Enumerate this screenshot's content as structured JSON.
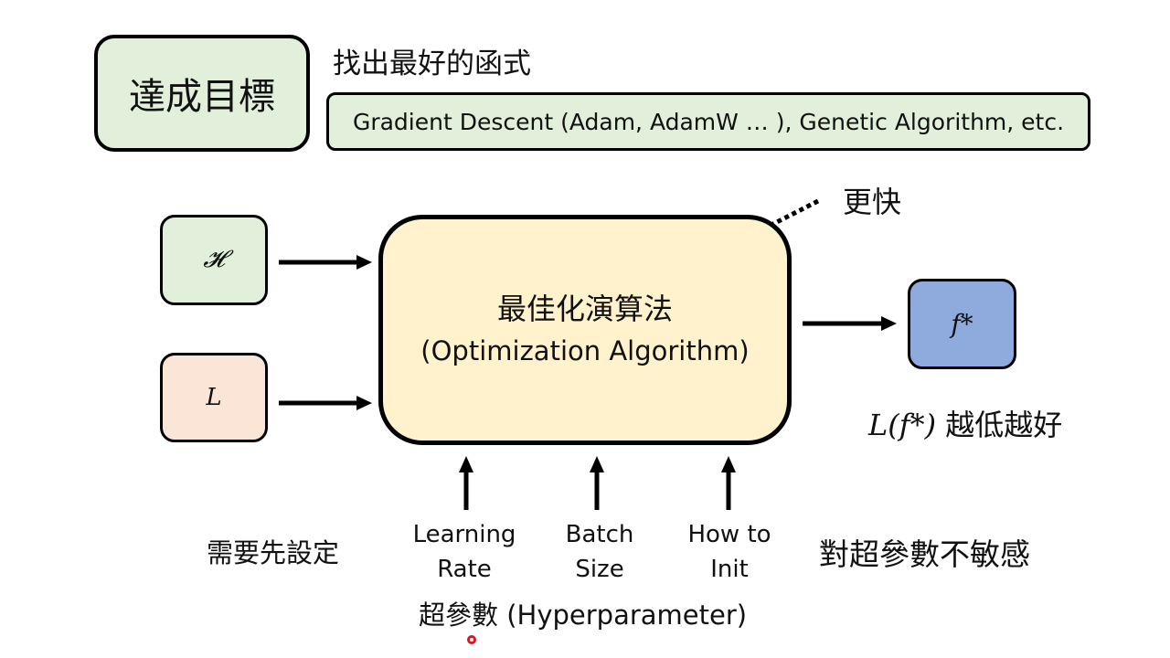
{
  "goal": {
    "label": "達成目標"
  },
  "find": {
    "title": "找出最好的函式",
    "methods": "Gradient Descent (Adam, AdamW … ), Genetic Algorithm, etc."
  },
  "inputs": {
    "hypothesis": "𝓗",
    "loss": "L"
  },
  "optimizer": {
    "title_zh": "最佳化演算法",
    "title_en": "(Optimization Algorithm)"
  },
  "output": {
    "label": "f*",
    "loss_expr": "L(f*)",
    "loss_note": "越低越好"
  },
  "faster_note": "更快",
  "hyperparameters": {
    "items": [
      {
        "line1": "Learning",
        "line2": "Rate"
      },
      {
        "line1": "Batch",
        "line2": "Size"
      },
      {
        "line1": "How to",
        "line2": "Init"
      }
    ],
    "label": "超參數 (Hyperparameter)",
    "need_set": "需要先設定",
    "insensitive": "對超參數不敏感"
  }
}
